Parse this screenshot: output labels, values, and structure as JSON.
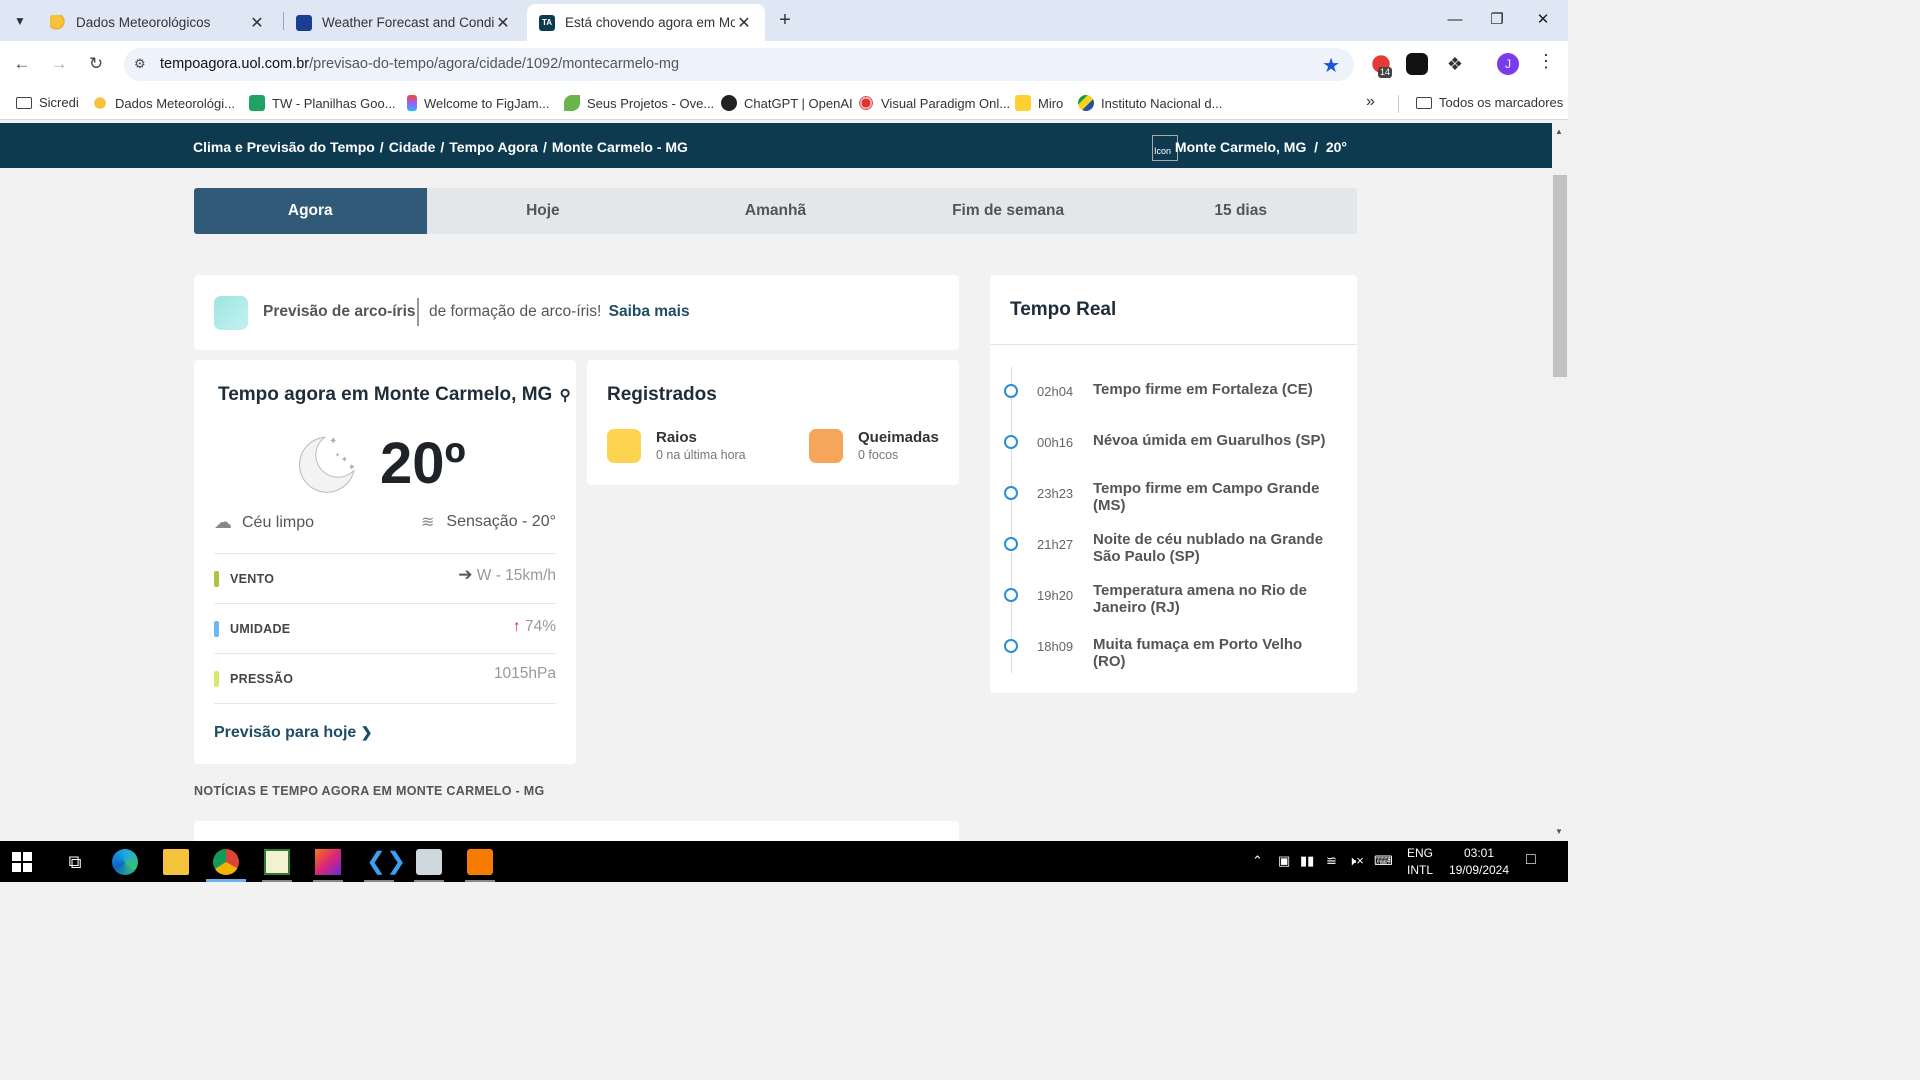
{
  "browser": {
    "tabs": [
      {
        "title": "Dados Meteorológicos",
        "active": false
      },
      {
        "title": "Weather Forecast and Conditions",
        "active": false
      },
      {
        "title": "Está chovendo agora em Monte Carmelo",
        "active": true
      }
    ],
    "url_host": "tempoagora.uol.com.br",
    "url_path": "/previsao-do-tempo/agora/cidade/1092/montecarmelo-mg",
    "extension_badge": "14",
    "profile_initial": "J",
    "bookmarks": [
      "Sicredi",
      "Dados Meteorológi...",
      "TW - Planilhas Goo...",
      "Welcome to FigJam...",
      "Seus Projetos - Ove...",
      "ChatGPT | OpenAI",
      "Visual Paradigm Onl...",
      "Miro",
      "Instituto Nacional d..."
    ],
    "bookmarks_folder": "Todos os marcadores"
  },
  "site": {
    "breadcrumb": [
      "Clima e Previsão do Tempo",
      "Cidade",
      "Tempo Agora",
      "Monte Carmelo - MG"
    ],
    "header_location": "Monte Carmelo, MG",
    "header_temp": "20°",
    "broken_image_alt": "Icon",
    "tabs": [
      "Agora",
      "Hoje",
      "Amanhã",
      "Fim de semana",
      "15 dias"
    ],
    "rainbow": {
      "label": "Previsão de arco-íris",
      "text": "de formação de arco-íris!",
      "link": "Saiba mais"
    },
    "now": {
      "title": "Tempo agora em Monte Carmelo, MG",
      "temperature": "20º",
      "condition": "Céu limpo",
      "feels_like": "Sensação - 20°",
      "rows": [
        {
          "label": "VENTO",
          "value": "W - 15km/h",
          "color": "#a8c640"
        },
        {
          "label": "UMIDADE",
          "value": "74%",
          "color": "#6fb7f2"
        },
        {
          "label": "PRESSÃO",
          "value": "1015hPa",
          "color": "#d8e86a"
        }
      ],
      "more_link": "Previsão para hoje"
    },
    "registered": {
      "title": "Registrados",
      "items": [
        {
          "name": "Raios",
          "sub": "0 na última hora",
          "color": "#fcd44f"
        },
        {
          "name": "Queimadas",
          "sub": "0 focos",
          "color": "#f5a65b"
        }
      ]
    },
    "news_heading": "NOTÍCIAS E TEMPO AGORA EM MONTE CARMELO - MG",
    "realtime": {
      "title": "Tempo Real",
      "items": [
        {
          "time": "02h04",
          "text": "Tempo firme em Fortaleza (CE)"
        },
        {
          "time": "00h16",
          "text": "Névoa úmida em Guarulhos (SP)"
        },
        {
          "time": "23h23",
          "text": "Tempo firme em Campo Grande (MS)"
        },
        {
          "time": "21h27",
          "text": "Noite de céu nublado na Grande São Paulo (SP)"
        },
        {
          "time": "19h20",
          "text": "Temperatura amena no Rio de Janeiro (RJ)"
        },
        {
          "time": "18h09",
          "text": "Muita fumaça em Porto Velho (RO)"
        }
      ]
    }
  },
  "taskbar": {
    "lang_line1": "ENG",
    "lang_line2": "INTL",
    "time": "03:01",
    "date": "19/09/2024"
  }
}
